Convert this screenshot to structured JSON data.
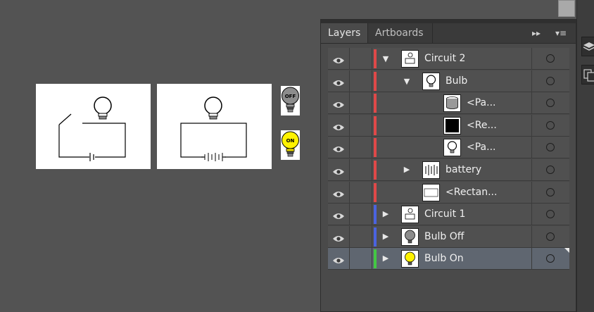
{
  "canvas": {
    "thumbnails": {
      "off_label": "OFF",
      "on_label": "ON"
    }
  },
  "panel": {
    "tabs": [
      {
        "label": "Layers",
        "active": true
      },
      {
        "label": "Artboards",
        "active": false
      }
    ],
    "menu_glyph": "▸▸",
    "options_glyph": "▾≡"
  },
  "layers": [
    {
      "name": "Circuit 2",
      "color": "#e04848",
      "indent": 0,
      "expanded": true,
      "has_children": true,
      "selected": false,
      "thumb": "circuit"
    },
    {
      "name": "Bulb",
      "color": "#e04848",
      "indent": 1,
      "expanded": true,
      "has_children": true,
      "selected": false,
      "thumb": "bulb"
    },
    {
      "name": "<Pa...",
      "color": "#e04848",
      "indent": 2,
      "expanded": false,
      "has_children": false,
      "selected": false,
      "thumb": "cylinder"
    },
    {
      "name": "<Re...",
      "color": "#e04848",
      "indent": 2,
      "expanded": false,
      "has_children": false,
      "selected": false,
      "thumb": "black"
    },
    {
      "name": "<Pa...",
      "color": "#e04848",
      "indent": 2,
      "expanded": false,
      "has_children": false,
      "selected": false,
      "thumb": "bulb"
    },
    {
      "name": "battery",
      "color": "#e04848",
      "indent": 1,
      "expanded": false,
      "has_children": true,
      "selected": false,
      "thumb": "battery"
    },
    {
      "name": "<Rectan...",
      "color": "#e04848",
      "indent": 1,
      "expanded": false,
      "has_children": false,
      "selected": false,
      "thumb": "rect"
    },
    {
      "name": "Circuit 1",
      "color": "#4a63e0",
      "indent": 0,
      "expanded": false,
      "has_children": true,
      "selected": false,
      "thumb": "circuit"
    },
    {
      "name": "Bulb Off",
      "color": "#4a63e0",
      "indent": 0,
      "expanded": false,
      "has_children": true,
      "selected": false,
      "thumb": "bulboff"
    },
    {
      "name": "Bulb On",
      "color": "#43c843",
      "indent": 0,
      "expanded": false,
      "has_children": true,
      "selected": true,
      "thumb": "bulbon"
    }
  ]
}
